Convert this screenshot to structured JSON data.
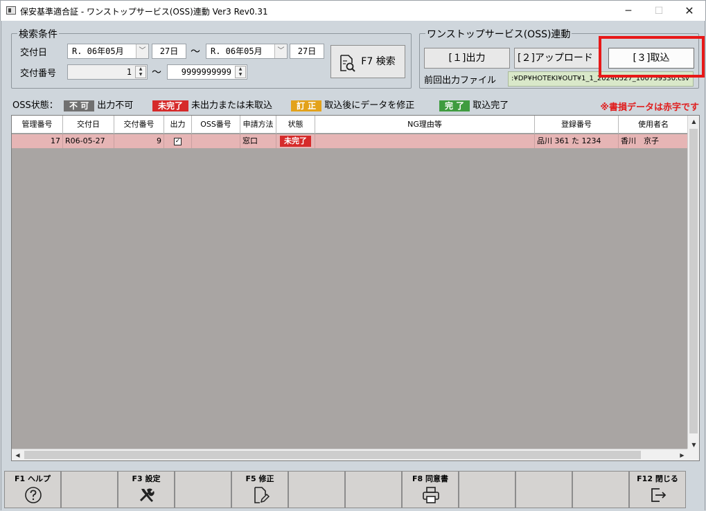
{
  "window": {
    "title": "保安基準適合証 - ワンストップサービス(OSS)連動 Ver3 Rev0.31",
    "min": "─",
    "max": "☐",
    "close": "✕"
  },
  "search": {
    "group_label": "検索条件",
    "issue_date_label": "交付日",
    "from_month": "R. 06年05月",
    "from_day": "27日",
    "to_month": "R. 06年05月",
    "to_day": "27日",
    "tilde": "～",
    "issue_no_label": "交付番号",
    "issue_no_from": "1",
    "issue_no_to": "9999999999",
    "search_button": "F7 検索"
  },
  "oss": {
    "group_label": "ワンストップサービス(OSS)連動",
    "output_button": "[１]出力",
    "upload_button": "[２]アップロード",
    "import_button": "[３]取込",
    "last_file_label": "前回出力ファイル",
    "last_file_path": ":¥DP¥HOTEKI¥OUT¥1_1_20240527_100759330.csv"
  },
  "legend": {
    "label": "OSS状態：",
    "items": [
      {
        "badge": "不 可",
        "text": "出力不可",
        "color": "#707070"
      },
      {
        "badge": "未完了",
        "text": "未出力または未取込",
        "color": "#d62a2a"
      },
      {
        "badge": "訂 正",
        "text": "取込後にデータを修正",
        "color": "#e3a21a"
      },
      {
        "badge": "完 了",
        "text": "取込完了",
        "color": "#3f9c3f"
      }
    ],
    "note": "※書損データは赤字です"
  },
  "grid": {
    "headers": [
      "管理番号",
      "交付日",
      "交付番号",
      "出力",
      "OSS番号",
      "申請方法",
      "状態",
      "NG理由等",
      "登録番号",
      "使用者名"
    ],
    "rows": [
      {
        "mgmt_no": "17",
        "issue_date": "R06-05-27",
        "issue_no": "9",
        "output_checked": "✓",
        "oss_no": "",
        "method": "窓口",
        "state": "未完了",
        "ng_reason": "",
        "reg_no": "品川 361 た 1234",
        "user_name": "香川　京子"
      }
    ]
  },
  "fkeys": [
    {
      "label": "F1 ヘルプ",
      "icon": "help-icon"
    },
    {
      "label": "",
      "icon": ""
    },
    {
      "label": "F3 設定",
      "icon": "tools-icon"
    },
    {
      "label": "",
      "icon": ""
    },
    {
      "label": "F5 修正",
      "icon": "edit-document-icon"
    },
    {
      "label": "",
      "icon": ""
    },
    {
      "label": "",
      "icon": ""
    },
    {
      "label": "F8 同意書",
      "icon": "printer-icon"
    },
    {
      "label": "",
      "icon": ""
    },
    {
      "label": "",
      "icon": ""
    },
    {
      "label": "",
      "icon": ""
    },
    {
      "label": "F12 閉じる",
      "icon": "exit-icon"
    }
  ]
}
